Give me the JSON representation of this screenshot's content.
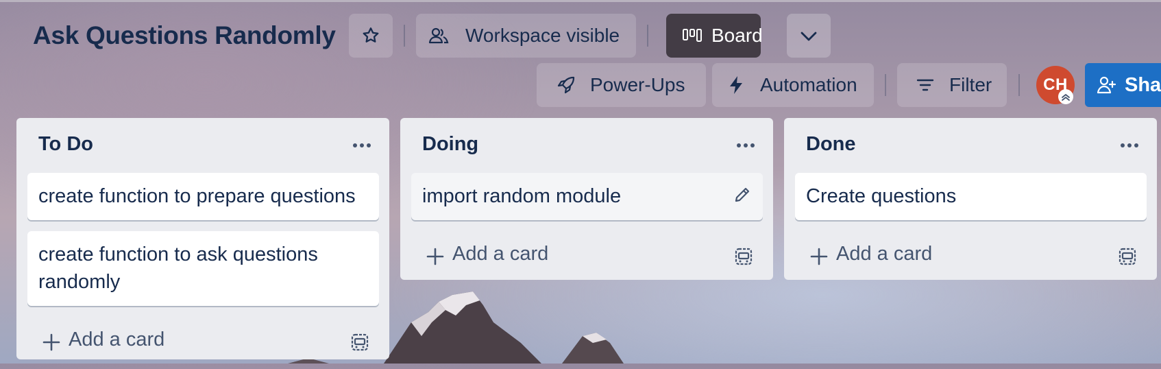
{
  "board": {
    "title": "Ask Questions Randomly",
    "visibility_label": "Workspace visible",
    "view_label": "Board"
  },
  "toolbar": {
    "powerups_label": "Power-Ups",
    "automation_label": "Automation",
    "filter_label": "Filter",
    "share_label": "Share"
  },
  "member": {
    "initials": "CH"
  },
  "lists": [
    {
      "title": "To Do",
      "cards": [
        "create function to prepare questions",
        "create function to ask questions randomly"
      ],
      "add_label": "Add a card"
    },
    {
      "title": "Doing",
      "cards": [
        "import random module"
      ],
      "add_label": "Add a card"
    },
    {
      "title": "Done",
      "cards": [
        "Create questions"
      ],
      "add_label": "Add a card"
    }
  ],
  "colors": {
    "text": "#172b4d",
    "list_bg": "#ebecf0",
    "share_bg": "#1d6fc5",
    "avatar_bg": "#cf4a2f",
    "board_button_bg": "#433c45"
  }
}
